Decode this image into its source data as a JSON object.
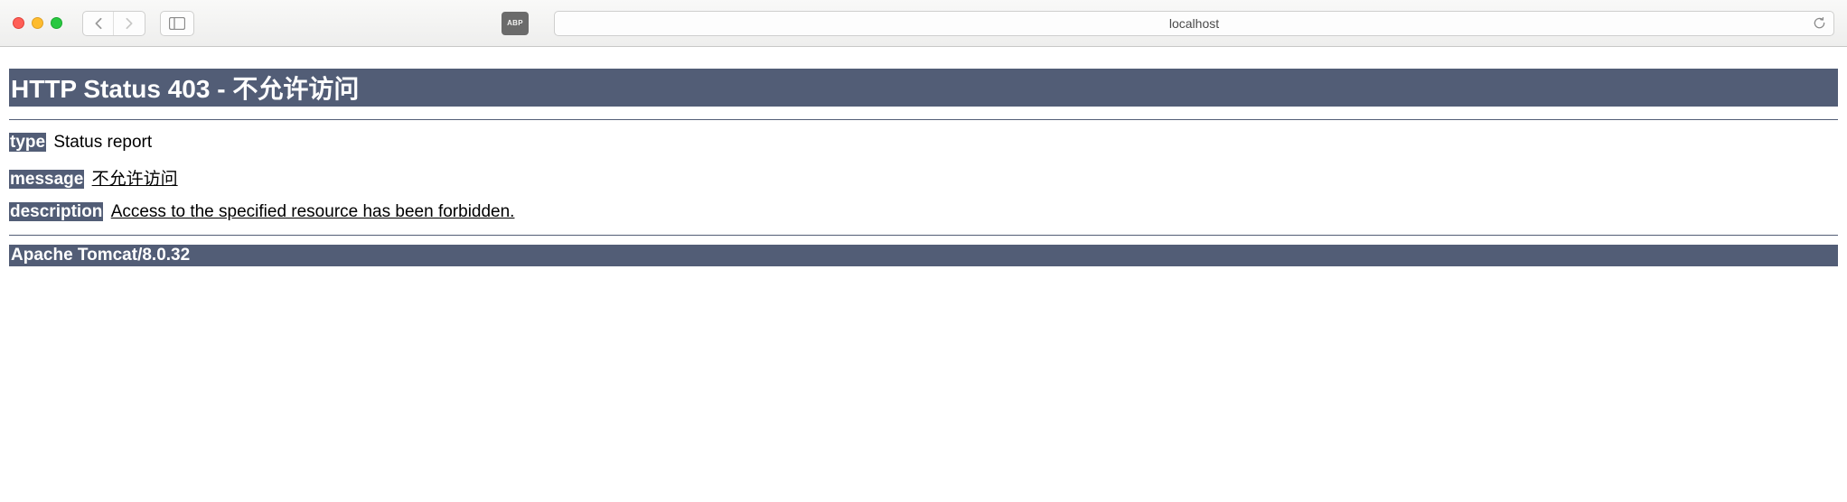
{
  "toolbar": {
    "abp_label": "ABP",
    "address": "localhost"
  },
  "page": {
    "status_heading": "HTTP Status 403 - 不允许访问",
    "rows": [
      {
        "label": "type",
        "value": "Status report",
        "underlined": false
      },
      {
        "label": "message",
        "value": "不允许访问",
        "underlined": true
      },
      {
        "label": "description",
        "value": "Access to the specified resource has been forbidden.",
        "underlined": true
      }
    ],
    "server": "Apache Tomcat/8.0.32"
  }
}
